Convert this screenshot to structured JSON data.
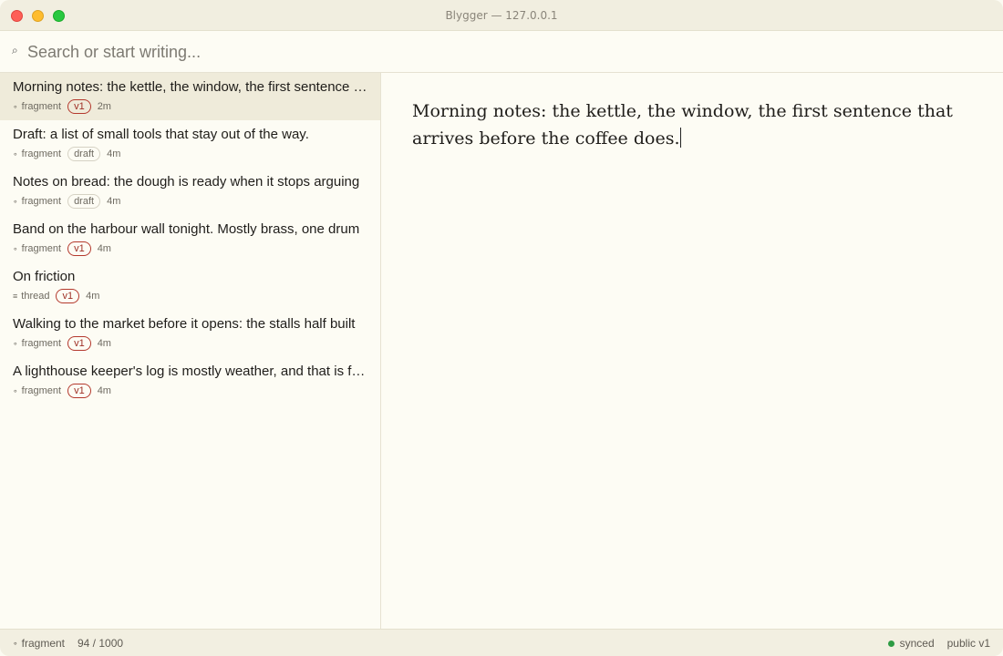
{
  "window": {
    "title": "Blygger — 127.0.0.1"
  },
  "search": {
    "placeholder": "Search or start writing..."
  },
  "colors": {
    "accent": "#9e2f25",
    "selected_bg": "#efebda",
    "sync_dot": "#2e9c44"
  },
  "sidebar": {
    "items": [
      {
        "title": "Morning notes: the kettle, the window, the first sentence that arrives before the coffee does.",
        "kind": "fragment",
        "kind_icon": "circle-icon",
        "badge": "v1",
        "age": "2m"
      },
      {
        "title": "Draft: a list of small tools that stay out of the way.",
        "kind": "fragment",
        "kind_icon": "circle-icon",
        "badge": "draft",
        "age": "4m"
      },
      {
        "title": "Notes on bread: the dough is ready when it stops arguing",
        "kind": "fragment",
        "kind_icon": "circle-icon",
        "badge": "draft",
        "age": "4m"
      },
      {
        "title": "Band on the harbour wall tonight. Mostly brass, one drum",
        "kind": "fragment",
        "kind_icon": "circle-icon",
        "badge": "v1",
        "age": "4m"
      },
      {
        "title": "On friction",
        "kind": "thread",
        "kind_icon": "lines-icon",
        "badge": "v1",
        "age": "4m"
      },
      {
        "title": "Walking to the market before it opens: the stalls half built",
        "kind": "fragment",
        "kind_icon": "circle-icon",
        "badge": "v1",
        "age": "4m"
      },
      {
        "title": "A lighthouse keeper's log is mostly weather, and that is fine",
        "kind": "fragment",
        "kind_icon": "circle-icon",
        "badge": "v1",
        "age": "4m"
      }
    ]
  },
  "editor": {
    "text": "Morning notes: the kettle, the window, the first sentence that arrives before the coffee does."
  },
  "status": {
    "kind": "fragment",
    "kind_icon": "circle-icon",
    "char_count": "94 / 1000",
    "sync": "synced",
    "visibility": "public v1"
  }
}
